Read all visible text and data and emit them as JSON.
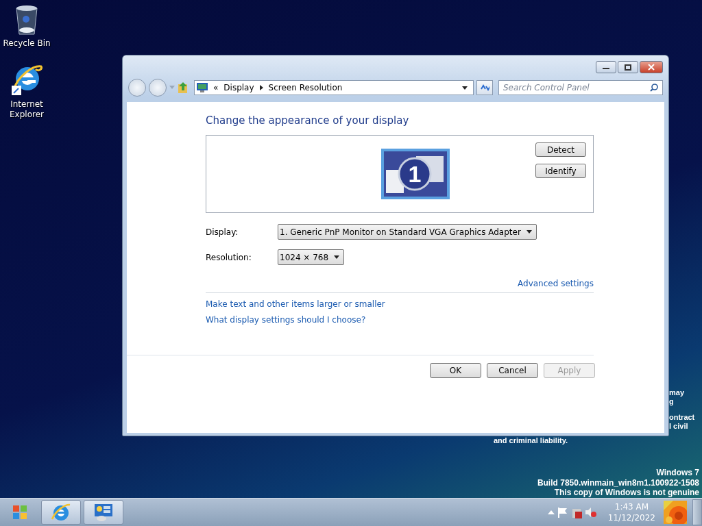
{
  "desktop": {
    "icons": [
      {
        "kind": "recycle",
        "label": "Recycle Bin"
      },
      {
        "kind": "ie",
        "label": "Internet Explorer"
      }
    ],
    "background_text": [
      "may",
      "g",
      "ontract",
      "l civil"
    ],
    "background_text_below": "and criminal liability.",
    "watermark": [
      "Windows 7",
      "Build 7850.winmain_win8m1.100922-1508",
      "This copy of Windows is not genuine"
    ]
  },
  "window": {
    "breadcrumb": [
      "Display",
      "Screen Resolution"
    ],
    "breadcrumb_prefix": "«",
    "search": {
      "placeholder": "Search Control Panel"
    },
    "heading": "Change the appearance of your display",
    "monitor": {
      "number": "1",
      "selected": true
    },
    "monitor_buttons": [
      "Detect",
      "Identify"
    ],
    "fields": [
      {
        "label": "Display:",
        "value": "1. Generic PnP Monitor on Standard VGA Graphics Adapter"
      },
      {
        "label": "Resolution:",
        "value": "1024 × 768"
      }
    ],
    "advanced_link": "Advanced settings",
    "links": [
      "Make text and other items larger or smaller",
      "What display settings should I choose?"
    ],
    "buttons": [
      {
        "label": "OK",
        "disabled": false
      },
      {
        "label": "Cancel",
        "disabled": false
      },
      {
        "label": "Apply",
        "disabled": true
      }
    ]
  },
  "taskbar": {
    "apps": [
      {
        "kind": "ie"
      },
      {
        "kind": "control-panel"
      }
    ],
    "clock": {
      "time": "1:43 AM",
      "date": "11/12/2022"
    }
  }
}
